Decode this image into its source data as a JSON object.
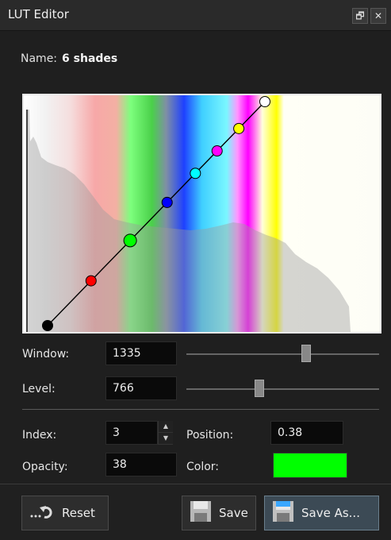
{
  "window": {
    "title": "LUT Editor",
    "btn_float": "🗗",
    "btn_close": "✕"
  },
  "name": {
    "label": "Name:",
    "value": "6 shades"
  },
  "lut": {
    "control_points": [
      {
        "pos": 0.0,
        "color": "#000000"
      },
      {
        "pos": 0.2,
        "color": "#ff0000"
      },
      {
        "pos": 0.38,
        "color": "#00ff00"
      },
      {
        "pos": 0.55,
        "color": "#0000ff"
      },
      {
        "pos": 0.68,
        "color": "#00ffff"
      },
      {
        "pos": 0.78,
        "color": "#ff00ff"
      },
      {
        "pos": 0.88,
        "color": "#ffff00"
      },
      {
        "pos": 1.0,
        "color": "#ffffff"
      }
    ]
  },
  "controls": {
    "window_label": "Window:",
    "window_value": "1335",
    "window_fraction": 0.62,
    "level_label": "Level:",
    "level_value": "766",
    "level_fraction": 0.38,
    "index_label": "Index:",
    "index_value": "3",
    "position_label": "Position:",
    "position_value": "0.38",
    "opacity_label": "Opacity:",
    "opacity_value": "38",
    "color_label": "Color:",
    "color_value": "#00ff00"
  },
  "buttons": {
    "reset": "Reset",
    "save": "Save",
    "save_as": "Save As..."
  }
}
